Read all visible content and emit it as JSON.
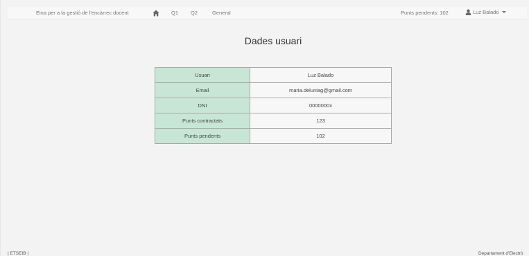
{
  "navbar": {
    "brand": "Eina per a la gestió de l'encàrrec docent",
    "links": {
      "q1": "Q1",
      "q2": "Q2",
      "general": "General"
    },
    "points_pending": "Punts pendents: 102",
    "user_name": "Luz Balado"
  },
  "page": {
    "title": "Dades usuari"
  },
  "table": [
    {
      "label": "Usuari",
      "value": "Luz Balado"
    },
    {
      "label": "Email",
      "value": "maria.deluniag@gmail.com"
    },
    {
      "label": "DNI",
      "value": "0000000x"
    },
    {
      "label": "Punts contractats",
      "value": "123"
    },
    {
      "label": "Punts pendents",
      "value": "102"
    }
  ],
  "footer": {
    "left": "| ETSEIB |",
    "right": "Departament d'Electrò"
  },
  "colors": {
    "label_bg": "#c8e6d5",
    "navbar_bg": "#f8f8f8",
    "page_bg": "#f3f3f3"
  }
}
